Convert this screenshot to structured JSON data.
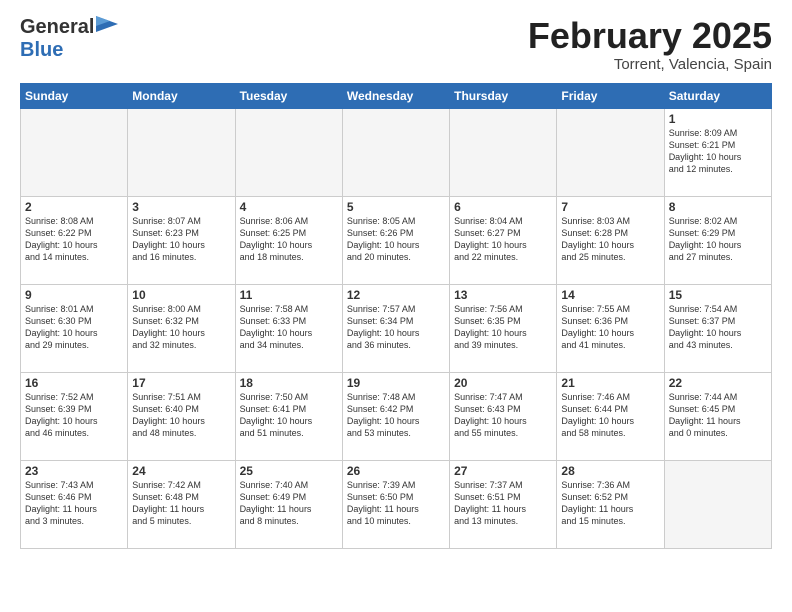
{
  "logo": {
    "general": "General",
    "blue": "Blue"
  },
  "header": {
    "title": "February 2025",
    "subtitle": "Torrent, Valencia, Spain"
  },
  "days_of_week": [
    "Sunday",
    "Monday",
    "Tuesday",
    "Wednesday",
    "Thursday",
    "Friday",
    "Saturday"
  ],
  "weeks": [
    [
      {
        "day": "",
        "info": "",
        "empty": true
      },
      {
        "day": "",
        "info": "",
        "empty": true
      },
      {
        "day": "",
        "info": "",
        "empty": true
      },
      {
        "day": "",
        "info": "",
        "empty": true
      },
      {
        "day": "",
        "info": "",
        "empty": true
      },
      {
        "day": "",
        "info": "",
        "empty": true
      },
      {
        "day": "1",
        "info": "Sunrise: 8:09 AM\nSunset: 6:21 PM\nDaylight: 10 hours\nand 12 minutes."
      }
    ],
    [
      {
        "day": "2",
        "info": "Sunrise: 8:08 AM\nSunset: 6:22 PM\nDaylight: 10 hours\nand 14 minutes."
      },
      {
        "day": "3",
        "info": "Sunrise: 8:07 AM\nSunset: 6:23 PM\nDaylight: 10 hours\nand 16 minutes."
      },
      {
        "day": "4",
        "info": "Sunrise: 8:06 AM\nSunset: 6:25 PM\nDaylight: 10 hours\nand 18 minutes."
      },
      {
        "day": "5",
        "info": "Sunrise: 8:05 AM\nSunset: 6:26 PM\nDaylight: 10 hours\nand 20 minutes."
      },
      {
        "day": "6",
        "info": "Sunrise: 8:04 AM\nSunset: 6:27 PM\nDaylight: 10 hours\nand 22 minutes."
      },
      {
        "day": "7",
        "info": "Sunrise: 8:03 AM\nSunset: 6:28 PM\nDaylight: 10 hours\nand 25 minutes."
      },
      {
        "day": "8",
        "info": "Sunrise: 8:02 AM\nSunset: 6:29 PM\nDaylight: 10 hours\nand 27 minutes."
      }
    ],
    [
      {
        "day": "9",
        "info": "Sunrise: 8:01 AM\nSunset: 6:30 PM\nDaylight: 10 hours\nand 29 minutes."
      },
      {
        "day": "10",
        "info": "Sunrise: 8:00 AM\nSunset: 6:32 PM\nDaylight: 10 hours\nand 32 minutes."
      },
      {
        "day": "11",
        "info": "Sunrise: 7:58 AM\nSunset: 6:33 PM\nDaylight: 10 hours\nand 34 minutes."
      },
      {
        "day": "12",
        "info": "Sunrise: 7:57 AM\nSunset: 6:34 PM\nDaylight: 10 hours\nand 36 minutes."
      },
      {
        "day": "13",
        "info": "Sunrise: 7:56 AM\nSunset: 6:35 PM\nDaylight: 10 hours\nand 39 minutes."
      },
      {
        "day": "14",
        "info": "Sunrise: 7:55 AM\nSunset: 6:36 PM\nDaylight: 10 hours\nand 41 minutes."
      },
      {
        "day": "15",
        "info": "Sunrise: 7:54 AM\nSunset: 6:37 PM\nDaylight: 10 hours\nand 43 minutes."
      }
    ],
    [
      {
        "day": "16",
        "info": "Sunrise: 7:52 AM\nSunset: 6:39 PM\nDaylight: 10 hours\nand 46 minutes."
      },
      {
        "day": "17",
        "info": "Sunrise: 7:51 AM\nSunset: 6:40 PM\nDaylight: 10 hours\nand 48 minutes."
      },
      {
        "day": "18",
        "info": "Sunrise: 7:50 AM\nSunset: 6:41 PM\nDaylight: 10 hours\nand 51 minutes."
      },
      {
        "day": "19",
        "info": "Sunrise: 7:48 AM\nSunset: 6:42 PM\nDaylight: 10 hours\nand 53 minutes."
      },
      {
        "day": "20",
        "info": "Sunrise: 7:47 AM\nSunset: 6:43 PM\nDaylight: 10 hours\nand 55 minutes."
      },
      {
        "day": "21",
        "info": "Sunrise: 7:46 AM\nSunset: 6:44 PM\nDaylight: 10 hours\nand 58 minutes."
      },
      {
        "day": "22",
        "info": "Sunrise: 7:44 AM\nSunset: 6:45 PM\nDaylight: 11 hours\nand 0 minutes."
      }
    ],
    [
      {
        "day": "23",
        "info": "Sunrise: 7:43 AM\nSunset: 6:46 PM\nDaylight: 11 hours\nand 3 minutes."
      },
      {
        "day": "24",
        "info": "Sunrise: 7:42 AM\nSunset: 6:48 PM\nDaylight: 11 hours\nand 5 minutes."
      },
      {
        "day": "25",
        "info": "Sunrise: 7:40 AM\nSunset: 6:49 PM\nDaylight: 11 hours\nand 8 minutes."
      },
      {
        "day": "26",
        "info": "Sunrise: 7:39 AM\nSunset: 6:50 PM\nDaylight: 11 hours\nand 10 minutes."
      },
      {
        "day": "27",
        "info": "Sunrise: 7:37 AM\nSunset: 6:51 PM\nDaylight: 11 hours\nand 13 minutes."
      },
      {
        "day": "28",
        "info": "Sunrise: 7:36 AM\nSunset: 6:52 PM\nDaylight: 11 hours\nand 15 minutes."
      },
      {
        "day": "",
        "info": "",
        "empty": true
      }
    ]
  ]
}
